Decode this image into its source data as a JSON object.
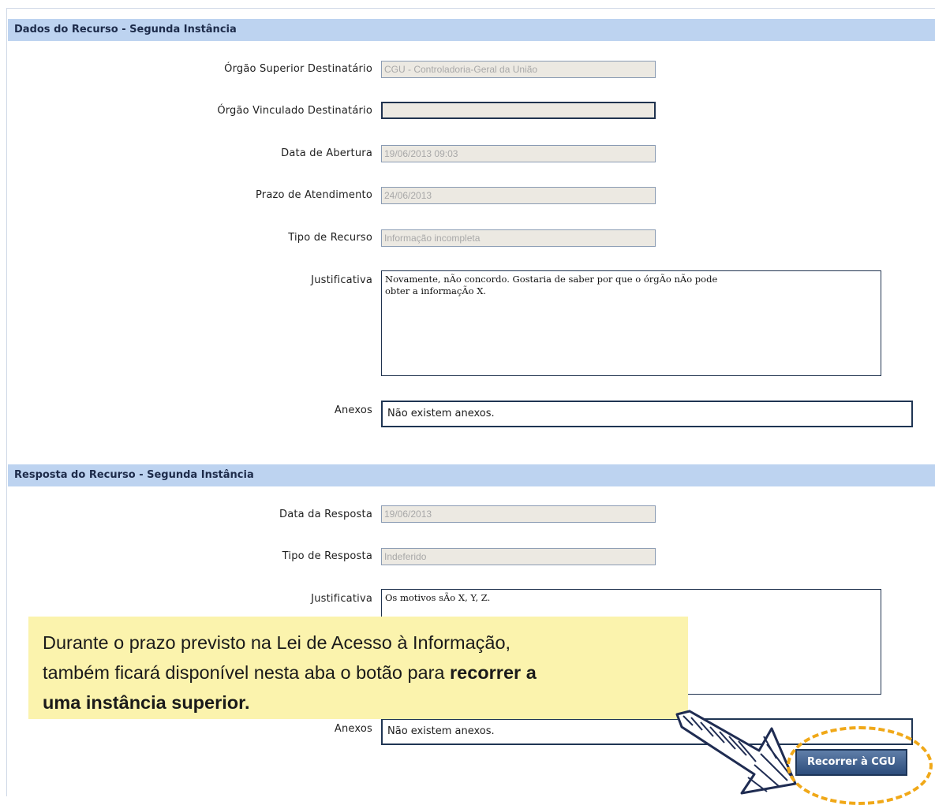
{
  "section1": {
    "header": "Dados do Recurso - Segunda Instância",
    "fields": {
      "orgao_superior": {
        "label": "Órgão Superior Destinatário",
        "value": "CGU - Controladoria-Geral da União"
      },
      "orgao_vinculado": {
        "label": "Órgão Vinculado Destinatário",
        "value": ""
      },
      "data_abertura": {
        "label": "Data de Abertura",
        "value": "19/06/2013 09:03"
      },
      "prazo_atendimento": {
        "label": "Prazo de Atendimento",
        "value": "24/06/2013"
      },
      "tipo_recurso": {
        "label": "Tipo de Recurso",
        "value": "Informação incompleta"
      },
      "justificativa": {
        "label": "Justificativa",
        "line1": "Novamente, nÃo concordo. Gostaria de saber por que o órgÃo nÃo pode",
        "line2": "obter a informaçÃo X."
      },
      "anexos": {
        "label": "Anexos",
        "value": "Não existem anexos."
      }
    }
  },
  "section2": {
    "header": "Resposta do Recurso - Segunda Instância",
    "fields": {
      "data_resposta": {
        "label": "Data da Resposta",
        "value": "19/06/2013"
      },
      "tipo_resposta": {
        "label": "Tipo de Resposta",
        "value": "Indeferido"
      },
      "justificativa": {
        "label": "Justificativa",
        "value": "Os motivos sÃo X, Y, Z."
      },
      "anexos": {
        "label": "Anexos",
        "value": "Não existem anexos."
      }
    }
  },
  "callout": {
    "line1": "Durante o prazo previsto na Lei de Acesso à Informação,",
    "line2_plain": "também ficará disponível nesta aba o botão para ",
    "line2_bold": "recorrer a",
    "line3_bold": "uma instância superior."
  },
  "button": {
    "label": "Recorrer à CGU"
  },
  "icons": {
    "arrow": "hand-drawn-arrow-icon",
    "highlight": "dashed-circle-highlight"
  },
  "colors": {
    "section_header_bg": "#bdd3f0",
    "callout_bg": "#fbf3ad",
    "highlight_ring": "#f0a818"
  }
}
